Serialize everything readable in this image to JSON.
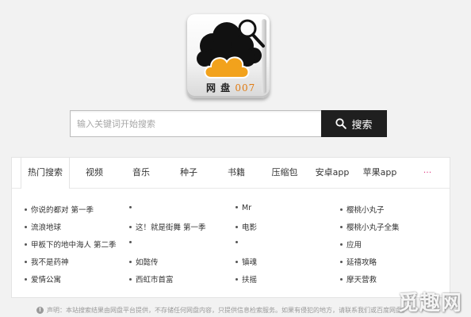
{
  "logo": {
    "brand_text": "网 盘",
    "brand_number": "007"
  },
  "search": {
    "placeholder": "输入关键词开始搜索",
    "value": "",
    "button_label": "搜索"
  },
  "tabs": [
    {
      "label": "热门搜索",
      "active": true
    },
    {
      "label": "视频"
    },
    {
      "label": "音乐"
    },
    {
      "label": "种子"
    },
    {
      "label": "书籍"
    },
    {
      "label": "压缩包"
    },
    {
      "label": "安卓app"
    },
    {
      "label": "苹果app"
    },
    {
      "label": "···"
    }
  ],
  "hot_columns": [
    [
      "你说的都对 第一季",
      "流浪地球",
      "甲板下的地中海人 第二季",
      "我不是药神",
      "爱情公寓"
    ],
    [
      "",
      "这！就是街舞 第一季",
      "",
      "如懿传",
      "西虹市首富"
    ],
    [
      "Mr",
      "电影",
      "",
      "镇魂",
      "扶摇"
    ],
    [
      "樱桃小丸子",
      "樱桃小丸子全集",
      "应用",
      "延禧攻略",
      "摩天营救"
    ]
  ],
  "disclaimer": "声明：本站搜索结果由网盘平台提供，不存储任何网盘内容，只提供信息检索服务。如果有侵犯的地方，请联系我们或百度网盘。",
  "watermark": "觅趣网"
}
